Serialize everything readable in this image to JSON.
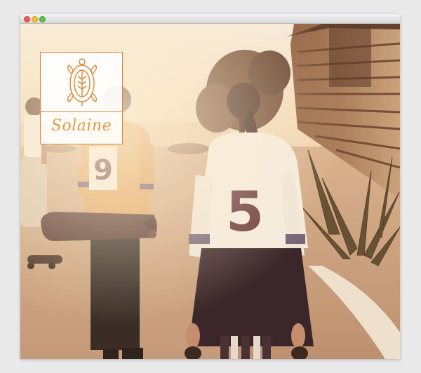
{
  "window": {
    "controls": [
      "close",
      "minimize",
      "zoom"
    ]
  },
  "logo": {
    "wordmark": "Solaine",
    "emblem_icon": "turtle-icon"
  },
  "photo": {
    "jersey_numbers": [
      "9",
      "5"
    ]
  },
  "colors": {
    "accent": "#d9893a",
    "sky": "#f6e3c4",
    "shadow": "#3a2620"
  }
}
